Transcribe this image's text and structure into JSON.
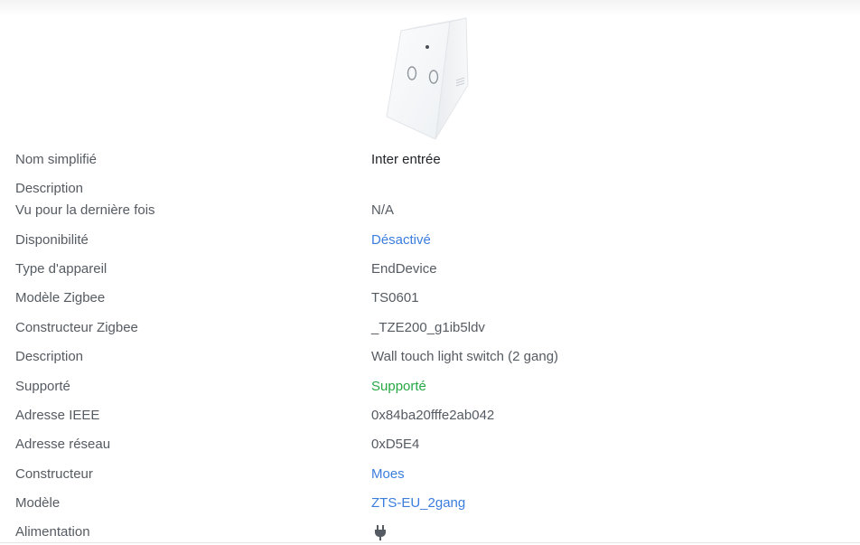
{
  "device": {
    "image_icon": "wall-switch-2gang-image",
    "properties": [
      {
        "key": "friendly_name",
        "label": "Nom simplifié",
        "value": "Inter entrée",
        "style": "dark"
      },
      {
        "key": "description_user",
        "label": "Description",
        "value": "",
        "style": "normal"
      },
      {
        "key": "last_seen",
        "label": "Vu pour la dernière fois",
        "value": "N/A",
        "style": "normal"
      },
      {
        "key": "availability",
        "label": "Disponibilité",
        "value": "Désactivé",
        "style": "link"
      },
      {
        "key": "device_type",
        "label": "Type d'appareil",
        "value": "EndDevice",
        "style": "normal"
      },
      {
        "key": "zigbee_model",
        "label": "Modèle Zigbee",
        "value": "TS0601",
        "style": "normal"
      },
      {
        "key": "zigbee_manufacturer",
        "label": "Constructeur Zigbee",
        "value": "_TZE200_g1ib5ldv",
        "style": "normal"
      },
      {
        "key": "description",
        "label": "Description",
        "value": "Wall touch light switch (2 gang)",
        "style": "normal"
      },
      {
        "key": "supported",
        "label": "Supporté",
        "value": "Supporté",
        "style": "ok"
      },
      {
        "key": "ieee_address",
        "label": "Adresse IEEE",
        "value": "0x84ba20fffe2ab042",
        "style": "normal"
      },
      {
        "key": "network_address",
        "label": "Adresse réseau",
        "value": "0xD5E4",
        "style": "normal"
      },
      {
        "key": "manufacturer",
        "label": "Constructeur",
        "value": "Moes",
        "style": "link"
      },
      {
        "key": "model",
        "label": "Modèle",
        "value": "ZTS-EU_2gang",
        "style": "link"
      },
      {
        "key": "power_source",
        "label": "Alimentation",
        "value": "",
        "icon": "plug-icon",
        "style": "icon"
      }
    ]
  },
  "colors": {
    "label": "#555b62",
    "value": "#555b62",
    "value_dark": "#212529",
    "link": "#3b7ddd",
    "success": "#28a745"
  }
}
